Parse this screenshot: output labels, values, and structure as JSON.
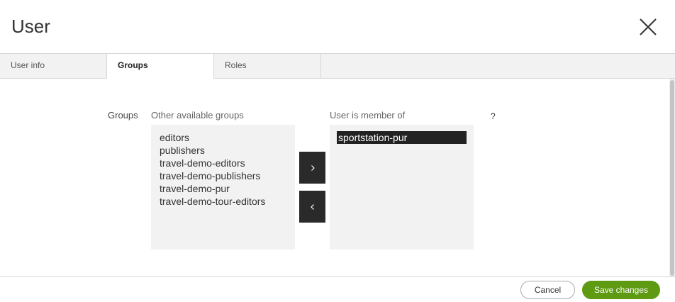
{
  "dialog": {
    "title": "User",
    "close_icon": "close-icon"
  },
  "tabs": [
    {
      "label": "User info",
      "active": false
    },
    {
      "label": "Groups",
      "active": true
    },
    {
      "label": "Roles",
      "active": false
    }
  ],
  "groups_section": {
    "label": "Groups",
    "available_label": "Other available groups",
    "available_groups": [
      "editors",
      "publishers",
      "travel-demo-editors",
      "travel-demo-publishers",
      "travel-demo-pur",
      "travel-demo-tour-editors"
    ],
    "member_label": "User is member of",
    "member_groups": [
      "sportstation-pur"
    ],
    "selected_member": "sportstation-pur",
    "add_icon": "chevron-right-icon",
    "remove_icon": "chevron-left-icon",
    "help_text": "?"
  },
  "footer": {
    "cancel_label": "Cancel",
    "save_label": "Save changes"
  },
  "colors": {
    "save_button": "#5e9a12",
    "move_button": "#2a2a2a",
    "list_background": "#f2f2f2",
    "selected_item": "#222222"
  }
}
